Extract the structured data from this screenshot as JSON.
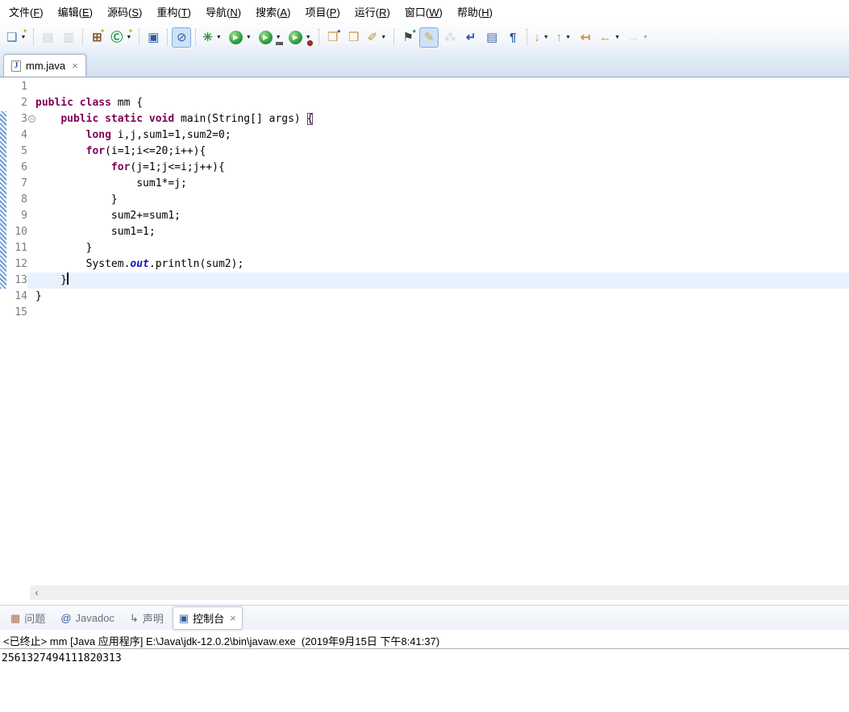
{
  "colors": {
    "keyword": "#7f0055",
    "static_field": "#1515c3",
    "current_line": "#e8f2fe",
    "line_number": "#7c7c7c",
    "tabstrip": "#d2e1f1",
    "pressed_bg": "#cde2f8"
  },
  "menu": {
    "items": [
      {
        "id": "file",
        "label": "文件(F)"
      },
      {
        "id": "edit",
        "label": "编辑(E)"
      },
      {
        "id": "source",
        "label": "源码(S)"
      },
      {
        "id": "refactor",
        "label": "重构(T)"
      },
      {
        "id": "navigate",
        "label": "导航(N)"
      },
      {
        "id": "search",
        "label": "搜索(A)"
      },
      {
        "id": "project",
        "label": "项目(P)"
      },
      {
        "id": "run",
        "label": "运行(R)"
      },
      {
        "id": "window",
        "label": "窗口(W)"
      },
      {
        "id": "help",
        "label": "帮助(H)"
      }
    ]
  },
  "toolbar": {
    "buttons": [
      {
        "name": "new-wizard-button",
        "glyph": "❏",
        "color": "#3b6db5",
        "overlay": "✦",
        "overlay_color": "#d59f1d",
        "dropdown": true
      },
      {
        "name": "save-button",
        "glyph": "▤",
        "color": "#8f8f8f",
        "disabled": true,
        "sep": true
      },
      {
        "name": "save-all-button",
        "glyph": "▥",
        "color": "#8f8f8f",
        "disabled": true
      },
      {
        "name": "new-java-project-button",
        "glyph": "⊞",
        "color": "#8a5a2a",
        "bold": true,
        "overlay": "✦",
        "overlay_color": "#d59f1d",
        "sep": true
      },
      {
        "name": "new-class-button",
        "glyph": "Ⓒ",
        "color": "#1f9d4d",
        "bold": true,
        "overlay": "✦",
        "overlay_color": "#d59f1d",
        "dropdown": true
      },
      {
        "name": "open-console-button",
        "glyph": "▣",
        "color": "#2c5aa0",
        "sep": true
      },
      {
        "name": "skip-breakpoints-toggle",
        "glyph": "⊘",
        "color": "#2c5aa0",
        "pressed": true,
        "sep": true
      },
      {
        "name": "debug-button",
        "glyph": "✳",
        "color": "#3c9140",
        "bold": true,
        "dropdown": true,
        "sep": true
      },
      {
        "name": "run-button",
        "circle": true,
        "dropdown": true
      },
      {
        "name": "coverage-button",
        "circle": true,
        "badge": "coverage",
        "dropdown": true
      },
      {
        "name": "profile-button",
        "circle": true,
        "badge": "red",
        "dropdown": true
      },
      {
        "name": "open-type-button",
        "glyph": "❒",
        "color": "#c8963c",
        "overlay": "●",
        "overlay_color": "#7a4a9e",
        "sep": true
      },
      {
        "name": "open-resource-button",
        "glyph": "❒",
        "color": "#c8963c"
      },
      {
        "name": "search-button",
        "glyph": "✐",
        "color": "#b58f2e",
        "dropdown": true
      },
      {
        "name": "last-edit-pin-button",
        "glyph": "⚑",
        "color": "#444444",
        "overlay": "●",
        "overlay_color": "#2f9e44",
        "sep": true
      },
      {
        "name": "mark-occurrences-toggle",
        "glyph": "✎",
        "color": "#d9a62e",
        "pressed": true
      },
      {
        "name": "step-filters-button",
        "glyph": "⁂",
        "color": "#999999",
        "disabled": true
      },
      {
        "name": "word-wrap-button",
        "glyph": "↵",
        "color": "#2c5aa0",
        "bold": true
      },
      {
        "name": "show-selected-element-button",
        "glyph": "▤",
        "color": "#4a6da8"
      },
      {
        "name": "show-whitespace-button",
        "glyph": "¶",
        "color": "#2c5aa0",
        "bold": true
      },
      {
        "name": "next-annotation-button",
        "glyph": "↓",
        "color": "#c8963c",
        "bold": true,
        "dropdown": true,
        "sep": true
      },
      {
        "name": "previous-annotation-button",
        "glyph": "↑",
        "color": "#c8963c",
        "bold": true,
        "dropdown": true
      },
      {
        "name": "last-edit-location-button",
        "glyph": "↤",
        "color": "#c8963c",
        "bold": true
      },
      {
        "name": "back-button",
        "glyph": "←",
        "color": "#c8963c",
        "bold": true,
        "dropdown": true
      },
      {
        "name": "forward-button",
        "glyph": "→",
        "color": "#aaaaaa",
        "bold": true,
        "disabled": true,
        "dropdown": true
      }
    ]
  },
  "editor_tab": {
    "title": "mm.java",
    "file_icon_letter": "J",
    "close_glyph": "×"
  },
  "editor": {
    "range_start": 3,
    "range_end": 13,
    "lines": [
      {
        "num": "1",
        "tokens": []
      },
      {
        "num": "2",
        "tokens": [
          {
            "s": "k",
            "t": "public"
          },
          {
            "t": " "
          },
          {
            "s": "k",
            "t": "class"
          },
          {
            "t": " mm {"
          }
        ]
      },
      {
        "num": "3",
        "fold": true,
        "tokens": [
          {
            "t": "    "
          },
          {
            "s": "k",
            "t": "public"
          },
          {
            "t": " "
          },
          {
            "s": "k",
            "t": "static"
          },
          {
            "t": " "
          },
          {
            "s": "k",
            "t": "void"
          },
          {
            "t": " main(String[] args) "
          },
          {
            "s": "b",
            "t": "{"
          }
        ]
      },
      {
        "num": "4",
        "tokens": [
          {
            "t": "        "
          },
          {
            "s": "k",
            "t": "long"
          },
          {
            "t": " i,j,sum1=1,sum2=0;"
          }
        ]
      },
      {
        "num": "5",
        "tokens": [
          {
            "t": "        "
          },
          {
            "s": "k",
            "t": "for"
          },
          {
            "t": "(i=1;i<=20;i++){"
          }
        ]
      },
      {
        "num": "6",
        "tokens": [
          {
            "t": "            "
          },
          {
            "s": "k",
            "t": "for"
          },
          {
            "t": "(j=1;j<=i;j++){"
          }
        ]
      },
      {
        "num": "7",
        "tokens": [
          {
            "t": "                sum1*=j;"
          }
        ]
      },
      {
        "num": "8",
        "tokens": [
          {
            "t": "            }"
          }
        ]
      },
      {
        "num": "9",
        "tokens": [
          {
            "t": "            sum2+=sum1;"
          }
        ]
      },
      {
        "num": "10",
        "tokens": [
          {
            "t": "            sum1=1;"
          }
        ]
      },
      {
        "num": "11",
        "tokens": [
          {
            "t": "        }"
          }
        ]
      },
      {
        "num": "12",
        "tokens": [
          {
            "t": "        System."
          },
          {
            "s": "f",
            "t": "out"
          },
          {
            "t": ".println(sum2);"
          }
        ]
      },
      {
        "num": "13",
        "current": true,
        "cursor": true,
        "tokens": [
          {
            "t": "    }"
          }
        ]
      },
      {
        "num": "14",
        "tokens": [
          {
            "t": "}"
          }
        ]
      },
      {
        "num": "15",
        "tokens": []
      }
    ]
  },
  "hscroll": {
    "left_arrow": "‹"
  },
  "bottom_tabs": {
    "items": [
      {
        "name": "problems",
        "label": "问题",
        "glyph": "▦",
        "icon": "problems-icon",
        "icon_color": "#b5694f"
      },
      {
        "name": "javadoc",
        "label": "Javadoc",
        "glyph": "@",
        "icon": "javadoc-icon",
        "icon_color": "#2c5aa0"
      },
      {
        "name": "declaration",
        "label": "声明",
        "glyph": "↳",
        "icon": "declaration-icon",
        "icon_color": "#4c7a3f"
      },
      {
        "name": "console",
        "label": "控制台",
        "glyph": "▣",
        "icon": "console-icon",
        "icon_color": "#2c5aa0",
        "active": true,
        "close": "×"
      }
    ]
  },
  "console": {
    "header": "<已终止> mm [Java 应用程序] E:\\Java\\jdk-12.0.2\\bin\\javaw.exe  (2019年9月15日 下午8:41:37)",
    "output": "2561327494111820313"
  }
}
